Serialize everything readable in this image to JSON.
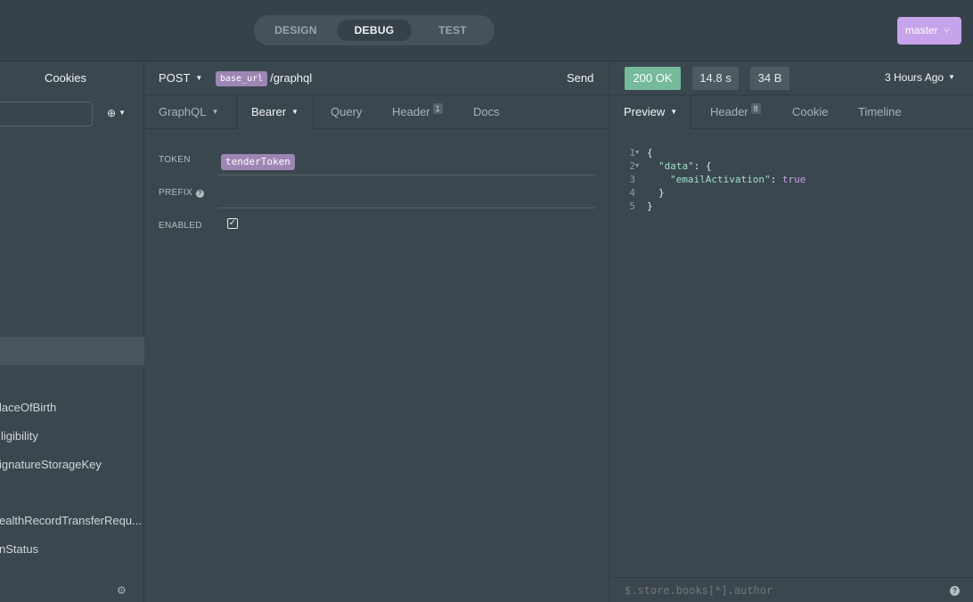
{
  "top": {
    "modes": [
      "DESIGN",
      "DEBUG",
      "TEST"
    ],
    "active_mode": "DEBUG",
    "branch": "master",
    "branch_icon": "git-branch-icon"
  },
  "sidebar": {
    "title": "Cookies",
    "filter_placeholder": "",
    "items": [
      {
        "label": "laceOfBirth"
      },
      {
        "label": "ligibility"
      },
      {
        "label": "ignatureStorageKey"
      },
      {
        "label": "ealthRecordTransferRequ..."
      },
      {
        "label": "nStatus"
      }
    ]
  },
  "request": {
    "method": "POST",
    "url_env_var": "base_url",
    "url_path": "/graphql",
    "send_label": "Send",
    "tabs": [
      {
        "label": "GraphQL"
      },
      {
        "label": "Bearer"
      },
      {
        "label": "Query"
      },
      {
        "label": "Header",
        "badge": "1"
      },
      {
        "label": "Docs"
      }
    ],
    "auth": {
      "token_label": "TOKEN",
      "token_value": "tenderToken",
      "prefix_label": "PREFIX",
      "enabled_label": "ENABLED",
      "enabled": true
    }
  },
  "response": {
    "status": "200 OK",
    "time": "14.8 s",
    "size": "34 B",
    "time_ago": "3 Hours Ago",
    "tabs": [
      {
        "label": "Preview"
      },
      {
        "label": "Header",
        "badge": "8"
      },
      {
        "label": "Cookie"
      },
      {
        "label": "Timeline"
      }
    ],
    "code_lines": [
      "1",
      "2",
      "3",
      "4",
      "5"
    ],
    "code": {
      "l1": "{",
      "l2_key": "\"data\"",
      "l2_rest": ": {",
      "l3_key": "\"emailActivation\"",
      "l3_colon": ": ",
      "l3_value": "true",
      "l4": "}",
      "l5": "}"
    },
    "filter_placeholder": "$.store.books[*].author"
  },
  "colors": {
    "accent": "#c6a3ea",
    "status_ok": "#75ba9b",
    "env_tag": "#9d86b4",
    "background": "#3b474f"
  }
}
